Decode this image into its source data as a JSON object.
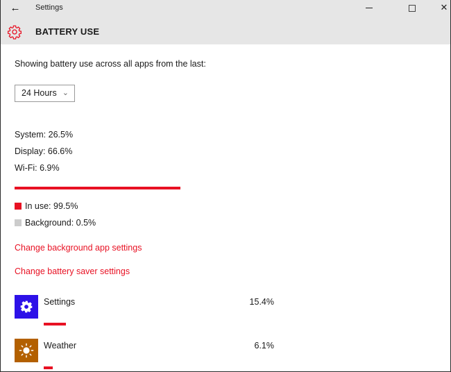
{
  "window": {
    "app_title": "Settings",
    "page_title": "BATTERY USE",
    "accent_color": "#e81123"
  },
  "main": {
    "intro": "Showing battery use across all apps from the last:",
    "time_range": {
      "selected": "24 Hours"
    },
    "stats": [
      {
        "label": "System: 26.5%"
      },
      {
        "label": "Display: 66.6%"
      },
      {
        "label": "Wi-Fi: 6.9%"
      }
    ],
    "usage": {
      "in_use_label": "In use: 99.5%",
      "in_use_percent": 99.5,
      "in_use_color": "#e81123",
      "background_label": "Background: 0.5%",
      "background_percent": 0.5,
      "background_color": "#cccccc"
    },
    "links": {
      "background_apps": "Change background app settings",
      "battery_saver": "Change battery saver settings"
    },
    "apps": [
      {
        "name": "Settings",
        "percent_label": "15.4%",
        "percent": 15.4,
        "icon": "gear-icon",
        "tile_color": "#2d11e8"
      },
      {
        "name": "Weather",
        "percent_label": "6.1%",
        "percent": 6.1,
        "icon": "sun-icon",
        "tile_color": "#b36000"
      }
    ]
  }
}
